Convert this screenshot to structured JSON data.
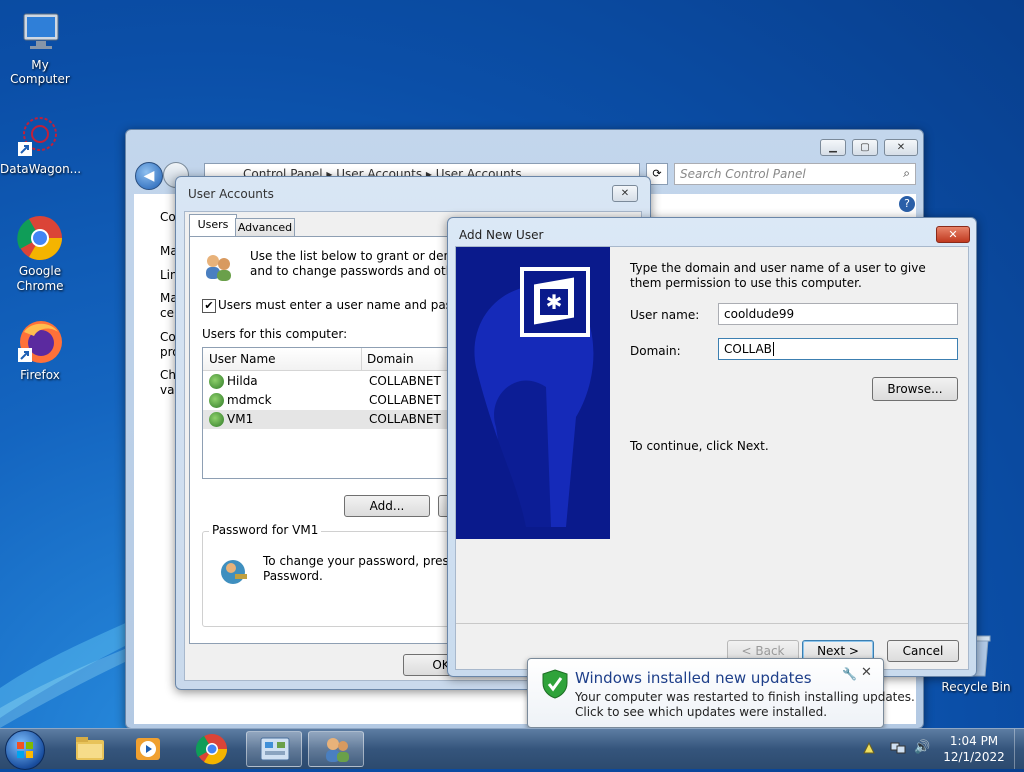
{
  "desktop": {
    "icons": [
      {
        "label": "My Computer"
      },
      {
        "label": "DataWagon..."
      },
      {
        "label": "Google Chrome"
      },
      {
        "label": "Firefox"
      },
      {
        "label": "Recycle Bin"
      }
    ]
  },
  "control_panel": {
    "breadcrumb": [
      "Control Panel",
      "User Accounts",
      "User Accounts"
    ],
    "search_placeholder": "Search Control Panel",
    "side_partial": [
      "Co",
      "Ma",
      "Lin",
      "Ma",
      "ce",
      "Co",
      "pro",
      "Ch",
      "va"
    ]
  },
  "user_accounts": {
    "title": "User Accounts",
    "tabs": [
      "Users",
      "Advanced"
    ],
    "intro": "Use the list below to grant or deny us",
    "intro2": "and to change passwords and other s",
    "checkbox_label": "Users must enter a user name and passwor",
    "users_heading": "Users for this computer:",
    "columns": [
      "User Name",
      "Domain"
    ],
    "rows": [
      {
        "name": "Hilda",
        "domain": "COLLABNET"
      },
      {
        "name": "mdmck",
        "domain": "COLLABNET"
      },
      {
        "name": "VM1",
        "domain": "COLLABNET"
      }
    ],
    "add_label": "Add...",
    "password_group": "Password for VM1",
    "password_text1": "To change your password, press C",
    "password_text2": "Password.",
    "ok_label": "OK"
  },
  "add_user": {
    "title": "Add New User",
    "instructions": "Type the domain and user name of a user to give them permission to use this computer.",
    "username_label": "User name:",
    "username_value": "cooldude99",
    "domain_label": "Domain:",
    "domain_value": "COLLAB",
    "browse_label": "Browse...",
    "continue_text": "To continue, click Next.",
    "back_label": "< Back",
    "next_label": "Next >",
    "cancel_label": "Cancel"
  },
  "notification": {
    "title": "Windows installed new updates",
    "line1": "Your computer was restarted to finish installing updates.",
    "line2": "Click to see which updates were installed."
  },
  "taskbar": {
    "time": "1:04 PM",
    "date": "12/1/2022"
  },
  "colors": {
    "banner": "#0a1a8c",
    "accent": "#1e5fb4"
  }
}
